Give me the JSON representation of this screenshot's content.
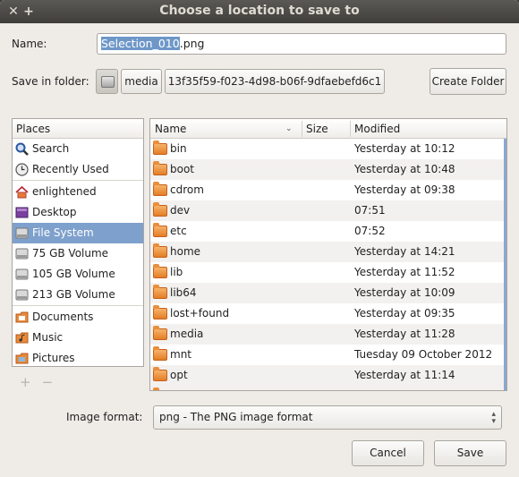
{
  "window": {
    "title": "Choose a location to save to"
  },
  "name": {
    "label": "Name:",
    "selected_part": "Selection_010",
    "rest": ".png"
  },
  "folder": {
    "label": "Save in folder:",
    "path": [
      "media",
      "13f35f59-f023-4d98-b06f-9dfaebefd6c1"
    ],
    "create_label": "Create Folder"
  },
  "places": {
    "header": "Places",
    "groups": [
      [
        {
          "label": "Search",
          "icon": "search-icon"
        },
        {
          "label": "Recently Used",
          "icon": "recent-icon"
        }
      ],
      [
        {
          "label": "enlightened",
          "icon": "home-icon"
        },
        {
          "label": "Desktop",
          "icon": "desktop-icon"
        },
        {
          "label": "File System",
          "icon": "drive-icon",
          "selected": true
        },
        {
          "label": "75 GB Volume",
          "icon": "drive-icon"
        },
        {
          "label": "105 GB Volume",
          "icon": "drive-icon"
        },
        {
          "label": "213 GB Volume",
          "icon": "drive-icon"
        }
      ],
      [
        {
          "label": "Documents",
          "icon": "documents-icon"
        },
        {
          "label": "Music",
          "icon": "music-icon"
        },
        {
          "label": "Pictures",
          "icon": "pictures-icon"
        }
      ]
    ],
    "add": "+",
    "remove": "−"
  },
  "files": {
    "columns": {
      "name": "Name",
      "size": "Size",
      "modified": "Modified"
    },
    "rows": [
      {
        "name": "bin",
        "modified": "Yesterday at 10:12"
      },
      {
        "name": "boot",
        "modified": "Yesterday at 10:48"
      },
      {
        "name": "cdrom",
        "modified": "Yesterday at 09:38"
      },
      {
        "name": "dev",
        "modified": "07:51"
      },
      {
        "name": "etc",
        "modified": "07:52"
      },
      {
        "name": "home",
        "modified": "Yesterday at 14:21"
      },
      {
        "name": "lib",
        "modified": "Yesterday at 11:52"
      },
      {
        "name": "lib64",
        "modified": "Yesterday at 10:09"
      },
      {
        "name": "lost+found",
        "modified": "Yesterday at 09:35"
      },
      {
        "name": "media",
        "modified": "Yesterday at 11:28"
      },
      {
        "name": "mnt",
        "modified": "Tuesday 09 October 2012"
      },
      {
        "name": "opt",
        "modified": "Yesterday at 11:14"
      }
    ]
  },
  "format": {
    "label": "Image format:",
    "value": "png - The PNG image format"
  },
  "buttons": {
    "cancel": "Cancel",
    "save": "Save"
  }
}
